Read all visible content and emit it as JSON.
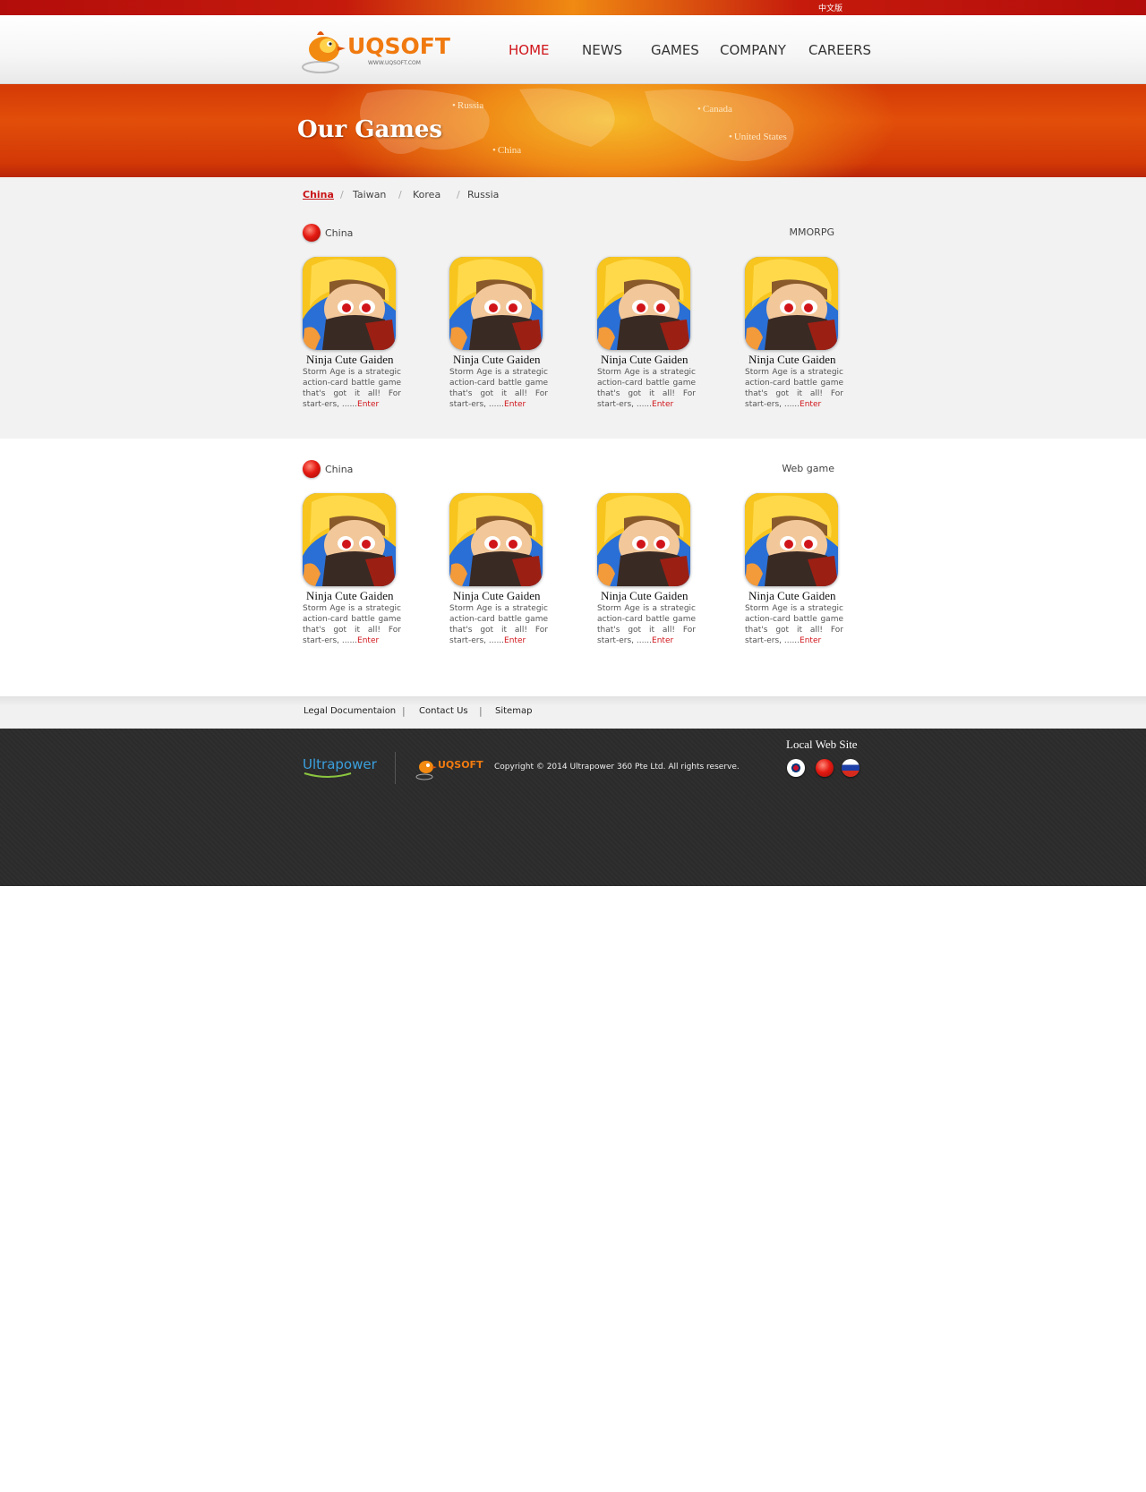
{
  "topbar": {
    "lang_link": "中文版"
  },
  "logo": {
    "name": "UQSOFT",
    "url": "WWW.UQSOFT.COM"
  },
  "nav": {
    "items": [
      {
        "label": "HOME",
        "active": true
      },
      {
        "label": "NEWS",
        "active": false
      },
      {
        "label": "GAMES",
        "active": false
      },
      {
        "label": "COMPANY",
        "active": false
      },
      {
        "label": "CAREERS",
        "active": false
      }
    ]
  },
  "banner": {
    "title": "Our Games",
    "cities": [
      "Russia",
      "Canada",
      "China",
      "United  States"
    ]
  },
  "tabs": {
    "items": [
      "China",
      "Taiwan",
      "Korea",
      "Russia"
    ],
    "active": "China",
    "separator": "/"
  },
  "sections": [
    {
      "region": "China",
      "genre": "MMORPG",
      "games": [
        {
          "name": "Ninja Cute Gaiden",
          "desc": "Storm Age is a strategic action-card battle game that's got it all! For start-ers, ......",
          "link": "Enter"
        },
        {
          "name": "Ninja Cute Gaiden",
          "desc": "Storm Age is a strategic action-card battle game that's got it all! For start-ers, ......",
          "link": "Enter"
        },
        {
          "name": "Ninja Cute Gaiden",
          "desc": "Storm Age is a strategic action-card battle game that's got it all! For start-ers, ......",
          "link": "Enter"
        },
        {
          "name": "Ninja Cute Gaiden",
          "desc": "Storm Age is a strategic action-card battle game that's got it all! For start-ers, ......",
          "link": "Enter"
        }
      ]
    },
    {
      "region": "China",
      "genre": "Web game",
      "games": [
        {
          "name": "Ninja Cute Gaiden",
          "desc": "Storm Age is a strategic action-card battle game that's got it all! For start-ers, ......",
          "link": "Enter"
        },
        {
          "name": "Ninja Cute Gaiden",
          "desc": "Storm Age is a strategic action-card battle game that's got it all! For start-ers, ......",
          "link": "Enter"
        },
        {
          "name": "Ninja Cute Gaiden",
          "desc": "Storm Age is a strategic action-card battle game that's got it all! For start-ers, ......",
          "link": "Enter"
        },
        {
          "name": "Ninja Cute Gaiden",
          "desc": "Storm Age is a strategic action-card battle game that's got it all! For start-ers, ......",
          "link": "Enter"
        }
      ]
    }
  ],
  "footer_links": [
    "Legal Documentaion",
    "Contact Us",
    "Sitemap"
  ],
  "footer": {
    "partner_logo": "Ultrapower",
    "mini_logo": "UQSOFT",
    "copyright": "Copyright © 2014 Ultrapower 360 Pte Ltd. All rights reserve.",
    "local_title": "Local Web Site",
    "local_sites": [
      {
        "icon": "korea-flag-icon"
      },
      {
        "icon": "china-flag-icon"
      },
      {
        "icon": "russia-flag-icon"
      }
    ]
  },
  "colors": {
    "accent": "#d0151a",
    "brand_orange": "#f07a10",
    "footer_bg": "#2c2c2c"
  }
}
